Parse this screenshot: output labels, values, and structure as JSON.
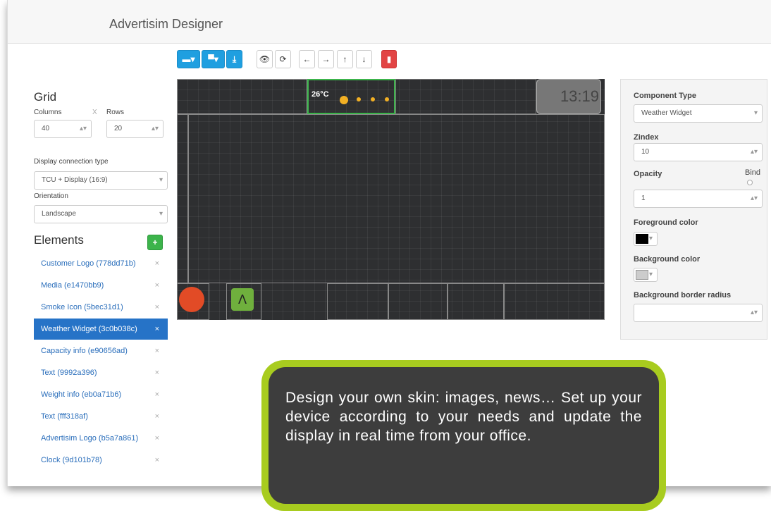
{
  "header": {
    "title": "Advertisim Designer"
  },
  "toolbar": {
    "view": "👁",
    "refresh": "⟳",
    "left": "←",
    "right": "→",
    "up": "↑",
    "down": "↓"
  },
  "grid": {
    "title": "Grid",
    "columns_label": "Columns",
    "rows_label": "Rows",
    "columns": "40",
    "rows": "20",
    "x": "X"
  },
  "display": {
    "label": "Display connection type",
    "value": "TCU + Display (16:9)",
    "orientation_label": "Orientation",
    "orientation": "Landscape"
  },
  "elements": {
    "title": "Elements",
    "items": [
      {
        "label": "Customer Logo (778dd71b)"
      },
      {
        "label": "Media (e1470bb9)"
      },
      {
        "label": "Smoke Icon (5bec31d1)"
      },
      {
        "label": "Weather Widget (3c0b038c)"
      },
      {
        "label": "Capacity info (e90656ad)"
      },
      {
        "label": "Text (9992a396)"
      },
      {
        "label": "Weight info (eb0a71b6)"
      },
      {
        "label": "Text (fff318af)"
      },
      {
        "label": "Advertisim Logo (b5a7a861)"
      },
      {
        "label": "Clock (9d101b78)"
      }
    ]
  },
  "canvas": {
    "temperature": "26°C",
    "clock": "13:19"
  },
  "props": {
    "component_type_label": "Component Type",
    "component_type": "Weather Widget",
    "zindex_label": "Zindex",
    "zindex": "10",
    "opacity_label": "Opacity",
    "bind_label": "Bind",
    "opacity": "1",
    "fg_label": "Foreground color",
    "bg_label": "Background color",
    "radius_label": "Background border radius",
    "radius": ""
  },
  "callout": {
    "text": "Design your own skin: images, news… Set up your device according to your needs and update the display in real time from your office."
  },
  "colors": {
    "accent": "#a8cc1f",
    "selected": "#2673c7",
    "canvas": "#2e2f31"
  }
}
